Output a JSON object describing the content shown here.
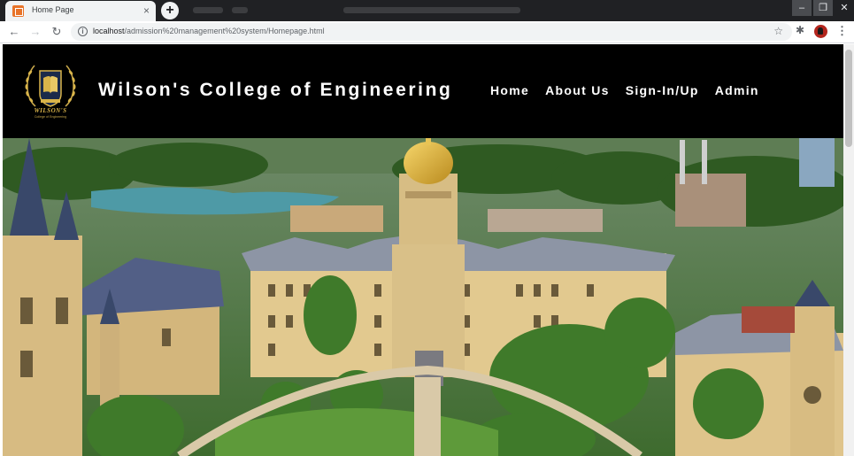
{
  "browser": {
    "tab_title": "Home Page",
    "tab_close": "×",
    "new_tab": "+",
    "url_host": "localhost",
    "url_path": "/admission%20management%20system/Homepage.html",
    "info_symbol": "i"
  },
  "site": {
    "logo_text": "WILSON'S",
    "logo_subtext": "College of Engineering",
    "title": "Wilson's College of Engineering",
    "nav": [
      "Home",
      "About Us",
      "Sign-In/Up",
      "Admin"
    ]
  },
  "hero": {
    "subject": "aerial view of college campus with golden dome"
  },
  "colors": {
    "header_bg": "#000000",
    "logo_gold": "#d9b44a",
    "tab_favicon": "#e8742a"
  }
}
